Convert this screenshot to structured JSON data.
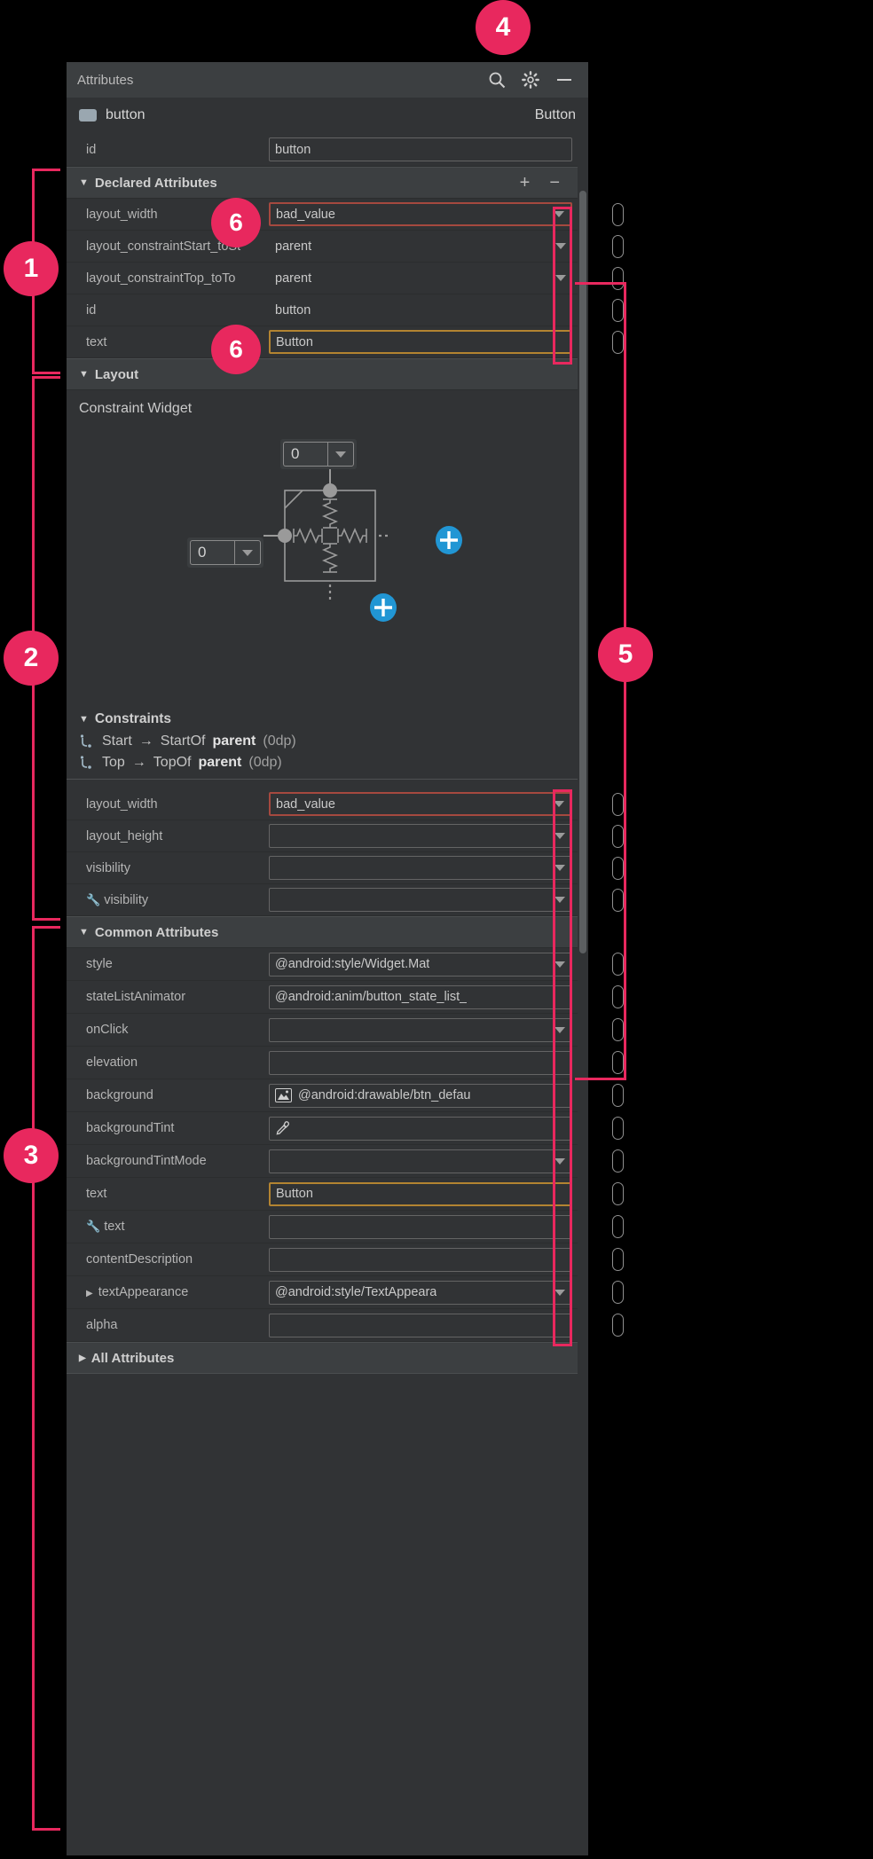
{
  "panel": {
    "header_title": "Attributes",
    "header_icons": [
      "search-icon",
      "gear-icon",
      "minimize-icon"
    ]
  },
  "widget": {
    "name": "button",
    "type": "Button"
  },
  "top_row": {
    "label": "id",
    "value": "button"
  },
  "declared_section": {
    "title": "Declared Attributes",
    "add_label": "+",
    "remove_label": "−",
    "rows": [
      {
        "label": "layout_width",
        "value": "bad_value",
        "state": "err",
        "combo": true
      },
      {
        "label": "layout_constraintStart_toSt",
        "value": "parent",
        "state": "none",
        "combo": true
      },
      {
        "label": "layout_constraintTop_toTo",
        "value": "parent",
        "state": "none",
        "combo": true
      },
      {
        "label": "id",
        "value": "button",
        "state": "none",
        "combo": false
      },
      {
        "label": "text",
        "value": "Button",
        "state": "warn",
        "combo": false
      }
    ]
  },
  "layout_section": {
    "title": "Layout",
    "constraint_widget_label": "Constraint Widget",
    "top_margin_value": "0",
    "left_margin_value": "0"
  },
  "constraints": {
    "title": "Constraints",
    "items": [
      {
        "icon": "constraint-arrow-icon",
        "from": "Start",
        "arrow": "→",
        "to": "StartOf",
        "target": "parent",
        "dim": "(0dp)"
      },
      {
        "icon": "constraint-arrow-icon",
        "from": "Top",
        "arrow": "→",
        "to": "TopOf",
        "target": "parent",
        "dim": "(0dp)"
      }
    ]
  },
  "layout_rows": [
    {
      "label": "layout_width",
      "value": "bad_value",
      "state": "err",
      "combo": true,
      "wrench": false
    },
    {
      "label": "layout_height",
      "value": "",
      "state": "plain",
      "combo": true,
      "wrench": false
    },
    {
      "label": "visibility",
      "value": "",
      "state": "plain",
      "combo": true,
      "wrench": false
    },
    {
      "label": "visibility",
      "value": "",
      "state": "plain",
      "combo": true,
      "wrench": true
    }
  ],
  "common_section": {
    "title": "Common Attributes",
    "rows": [
      {
        "label": "style",
        "value": "@android:style/Widget.Mat",
        "state": "plain",
        "combo": true,
        "wrench": false,
        "expand": false,
        "icon": ""
      },
      {
        "label": "stateListAnimator",
        "value": "@android:anim/button_state_list_",
        "state": "plain",
        "combo": false,
        "wrench": false,
        "expand": false,
        "icon": ""
      },
      {
        "label": "onClick",
        "value": "",
        "state": "plain",
        "combo": true,
        "wrench": false,
        "expand": false,
        "icon": ""
      },
      {
        "label": "elevation",
        "value": "",
        "state": "plain",
        "combo": false,
        "wrench": false,
        "expand": false,
        "icon": ""
      },
      {
        "label": "background",
        "value": "@android:drawable/btn_defau",
        "state": "plain",
        "combo": false,
        "wrench": false,
        "expand": false,
        "icon": "image-icon"
      },
      {
        "label": "backgroundTint",
        "value": "",
        "state": "plain",
        "combo": false,
        "wrench": false,
        "expand": false,
        "icon": "eyedropper-icon"
      },
      {
        "label": "backgroundTintMode",
        "value": "",
        "state": "plain",
        "combo": true,
        "wrench": false,
        "expand": false,
        "icon": ""
      },
      {
        "label": "text",
        "value": "Button",
        "state": "warn",
        "combo": false,
        "wrench": false,
        "expand": false,
        "icon": ""
      },
      {
        "label": "text",
        "value": "",
        "state": "plain",
        "combo": false,
        "wrench": true,
        "expand": false,
        "icon": ""
      },
      {
        "label": "contentDescription",
        "value": "",
        "state": "plain",
        "combo": false,
        "wrench": false,
        "expand": false,
        "icon": ""
      },
      {
        "label": "textAppearance",
        "value": "@android:style/TextAppeara",
        "state": "plain",
        "combo": true,
        "wrench": false,
        "expand": true,
        "icon": ""
      },
      {
        "label": "alpha",
        "value": "",
        "state": "plain",
        "combo": false,
        "wrench": false,
        "expand": false,
        "icon": ""
      }
    ]
  },
  "all_attributes_section": {
    "title": "All Attributes"
  },
  "callouts": [
    {
      "id": "1",
      "number": "1"
    },
    {
      "id": "2",
      "number": "2"
    },
    {
      "id": "3",
      "number": "3"
    },
    {
      "id": "4",
      "number": "4"
    },
    {
      "id": "5",
      "number": "5"
    },
    {
      "id": "6a",
      "number": "6"
    },
    {
      "id": "6b",
      "number": "6"
    }
  ],
  "colors": {
    "callout": "#e8285e",
    "error_border": "#a5493f",
    "warning_border": "#b38431",
    "panel_bg": "#313335",
    "header_bg": "#3c3f41",
    "accent_blue": "#2196d4"
  }
}
